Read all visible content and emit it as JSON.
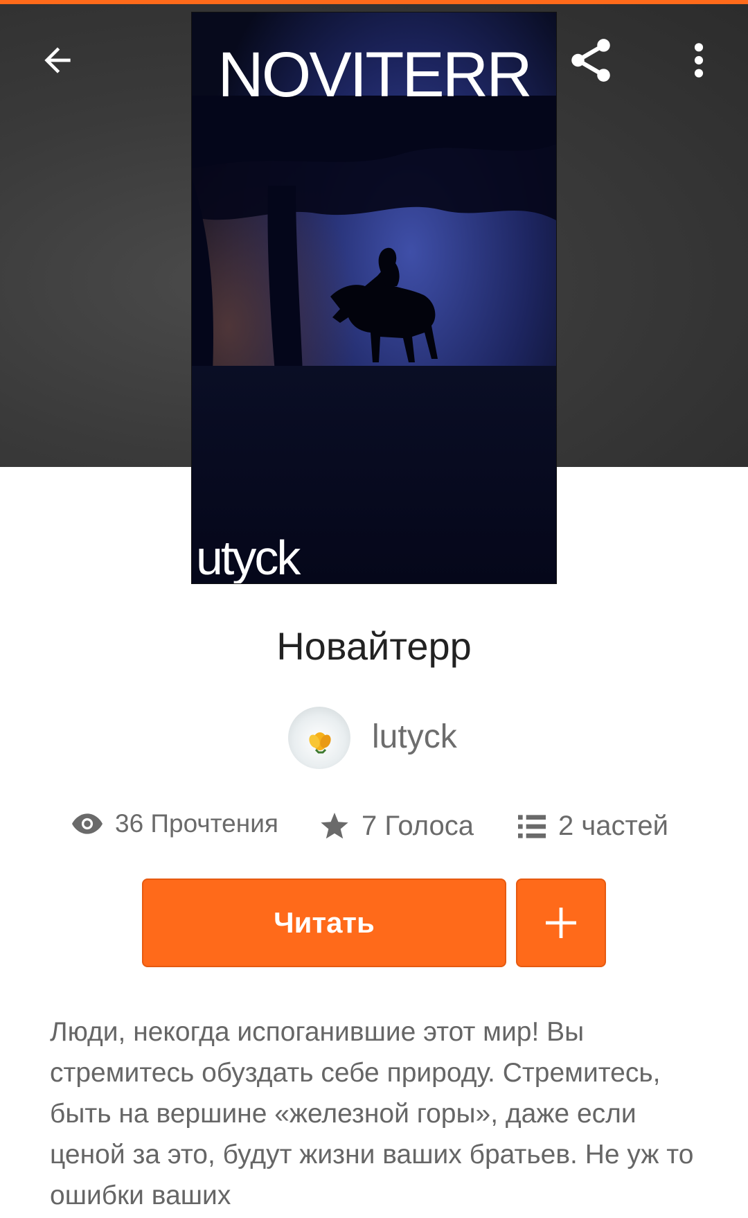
{
  "toolbar": {
    "back_icon": "arrow-left-icon",
    "share_icon": "share-icon",
    "more_icon": "more-vertical-icon"
  },
  "cover": {
    "title": "NOVITERR",
    "author": "utyck"
  },
  "book": {
    "title": "Новайтерр",
    "author": "lutyck"
  },
  "stats": {
    "reads": "36 Прочтения",
    "votes": "7 Голоса",
    "parts": "2 частей"
  },
  "actions": {
    "read_label": "Читать",
    "add_icon": "plus-icon"
  },
  "description": "Люди, некогда испоганившие этот мир! Вы стремитесь обуздать себе природу. Стремитесь, быть на вершине «железной горы», даже если ценой за это, будут жизни ваших братьев. Не уж то ошибки ваших",
  "colors": {
    "accent": "#ff6a1a",
    "header_bg": "#3a3a3a",
    "text_primary": "#222222",
    "text_secondary": "#6a6a6a"
  }
}
